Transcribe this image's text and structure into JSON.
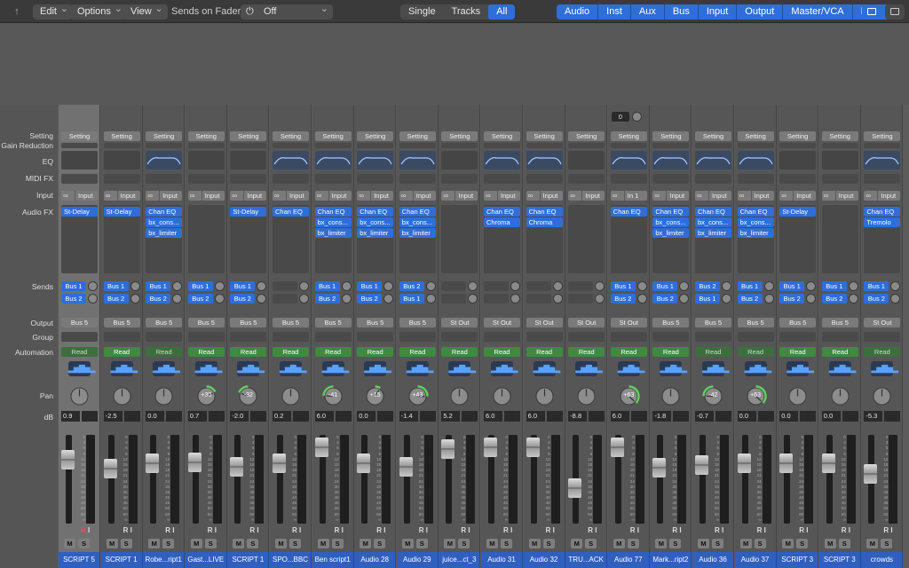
{
  "toolbar": {
    "edit": "Edit",
    "options": "Options",
    "view": "View",
    "sends_label": "Sends on Faders:",
    "sends_value": "Off",
    "views": [
      "Single",
      "Tracks",
      "All"
    ],
    "view_active": 2,
    "filters": [
      "Audio",
      "Inst",
      "Aux",
      "Bus",
      "Input",
      "Output",
      "Master/VCA",
      "MIDI"
    ]
  },
  "labels": {
    "setting": "Setting",
    "gain_reduction": "Gain Reduction",
    "eq": "EQ",
    "midi_fx": "MIDI FX",
    "input": "Input",
    "audio_fx": "Audio FX",
    "sends": "Sends",
    "output": "Output",
    "group": "Group",
    "automation": "Automation",
    "pan": "Pan",
    "db": "dB"
  },
  "common": {
    "setting": "Setting",
    "input": "Input",
    "read": "Read",
    "mute": "M",
    "solo": "S",
    "record": "R",
    "input_monitor": "I"
  },
  "scale": [
    "0",
    "3",
    "6",
    "9",
    "12",
    "15",
    "18",
    "21",
    "24",
    "30",
    "35",
    "40",
    "45",
    "50",
    "60",
    "∞"
  ],
  "channels": [
    {
      "name": "SCRIPT 5",
      "eq": false,
      "input": "Input",
      "fx": [
        "St-Delay"
      ],
      "sends": [
        "Bus 1",
        "Bus 2"
      ],
      "output": "Bus 5",
      "auto_dim": true,
      "pan": 0,
      "db": "0.9",
      "fader": 0.28,
      "rec": true,
      "sel": true
    },
    {
      "name": "SCRIPT 1",
      "eq": false,
      "input": "Input",
      "fx": [
        "St-Delay"
      ],
      "sends": [
        "Bus 1",
        "Bus 2"
      ],
      "output": "Bus 5",
      "auto_dim": false,
      "pan": 0,
      "db": "-2.5",
      "fader": 0.38,
      "rec": false
    },
    {
      "name": "Robe...ript1",
      "eq": true,
      "input": "Input",
      "fx": [
        "Chan EQ",
        "bx_cons...",
        "bx_limiter"
      ],
      "sends": [
        "Bus 1",
        "Bus 2"
      ],
      "output": "Bus 5",
      "auto_dim": true,
      "pan": 0,
      "db": "0.0",
      "fader": 0.32,
      "rec": false
    },
    {
      "name": "Gast...LIVE",
      "eq": false,
      "input": "Input",
      "fx": [],
      "sends": [
        "Bus 1",
        "Bus 2"
      ],
      "output": "Bus 5",
      "auto_dim": false,
      "pan": 30,
      "db": "0.7",
      "fader": 0.31,
      "rec": false
    },
    {
      "name": "SCRIPT 1",
      "eq": false,
      "input": "Input",
      "fx": [
        "St-Delay"
      ],
      "sends": [
        "Bus 1",
        "Bus 2"
      ],
      "output": "Bus 5",
      "auto_dim": false,
      "pan": -32,
      "db": "-2.0",
      "fader": 0.36,
      "rec": false
    },
    {
      "name": "SPO...BBC",
      "eq": true,
      "input": "Input",
      "fx": [
        "Chan EQ"
      ],
      "sends": [],
      "output": "Bus 5",
      "auto_dim": false,
      "pan": 0,
      "db": "0.2",
      "fader": 0.32,
      "rec": false
    },
    {
      "name": "Ben script1",
      "eq": true,
      "input": "Input",
      "fx": [
        "Chan EQ",
        "bx_cons...",
        "bx_limiter"
      ],
      "sends": [
        "Bus 1",
        "Bus 2"
      ],
      "output": "Bus 5",
      "auto_dim": false,
      "pan": -41,
      "db": "6.0",
      "fader": 0.14,
      "rec": false
    },
    {
      "name": "Audio 28",
      "eq": true,
      "input": "Input",
      "fx": [
        "Chan EQ",
        "bx_cons...",
        "bx_limiter"
      ],
      "sends": [
        "Bus 1",
        "Bus 2"
      ],
      "output": "Bus 5",
      "auto_dim": false,
      "pan": 15,
      "db": "0.0",
      "fader": 0.32,
      "rec": false
    },
    {
      "name": "Audio 29",
      "eq": true,
      "input": "Input",
      "fx": [
        "Chan EQ",
        "bx_cons...",
        "bx_limiter"
      ],
      "sends": [
        "Bus 2",
        "Bus 1"
      ],
      "output": "Bus 5",
      "auto_dim": false,
      "pan": 43,
      "db": "-1.4",
      "fader": 0.36,
      "rec": false
    },
    {
      "name": "juice...ct_3",
      "eq": false,
      "input": "Input",
      "fx": [],
      "sends": [],
      "output": "St Out",
      "auto_dim": false,
      "pan": 0,
      "db": "5.2",
      "fader": 0.16,
      "rec": false
    },
    {
      "name": "Audio 31",
      "eq": true,
      "input": "Input",
      "fx": [
        "Chan EQ",
        "Chroma"
      ],
      "sends": [],
      "output": "St Out",
      "auto_dim": false,
      "pan": 0,
      "db": "6.0",
      "fader": 0.14,
      "rec": false
    },
    {
      "name": "Audio 32",
      "eq": true,
      "input": "Input",
      "fx": [
        "Chan EQ",
        "Chroma"
      ],
      "sends": [],
      "output": "St Out",
      "auto_dim": false,
      "pan": 0,
      "db": "6.0",
      "fader": 0.14,
      "rec": false
    },
    {
      "name": "TRU...ACK",
      "eq": false,
      "input": "Input",
      "fx": [],
      "sends": [],
      "output": "St Out",
      "auto_dim": false,
      "pan": 0,
      "db": "-8.8",
      "fader": 0.6,
      "rec": false
    },
    {
      "name": "Audio 77",
      "eq": true,
      "input": "In 1",
      "fx": [
        "Chan EQ"
      ],
      "sends": [
        "Bus 1",
        "Bus 2"
      ],
      "output": "St Out",
      "auto_dim": false,
      "pan": 63,
      "db": "6.0",
      "fader": 0.14,
      "rec": false,
      "extra_value": "0"
    },
    {
      "name": "Mark...ript2",
      "eq": true,
      "input": "Input",
      "fx": [
        "Chan EQ",
        "bx_cons...",
        "bx_limiter"
      ],
      "sends": [
        "Bus 1",
        "Bus 2"
      ],
      "output": "Bus 5",
      "auto_dim": false,
      "pan": 0,
      "db": "-1.8",
      "fader": 0.37,
      "rec": false
    },
    {
      "name": "Audio 36",
      "eq": true,
      "input": "Input",
      "fx": [
        "Chan EQ",
        "bx_cons...",
        "bx_limiter"
      ],
      "sends": [
        "Bus 2",
        "Bus 1"
      ],
      "output": "Bus 5",
      "auto_dim": true,
      "pan": -42,
      "db": "-0.7",
      "fader": 0.34,
      "rec": false
    },
    {
      "name": "Audio 37",
      "eq": true,
      "input": "Input",
      "fx": [
        "Chan EQ",
        "bx_cons...",
        "bx_limiter"
      ],
      "sends": [
        "Bus 1",
        "Bus 2"
      ],
      "output": "Bus 5",
      "auto_dim": true,
      "pan": 63,
      "db": "0.0",
      "fader": 0.32,
      "rec": false
    },
    {
      "name": "SCRIPT 3",
      "eq": false,
      "input": "Input",
      "fx": [
        "St-Delay"
      ],
      "sends": [
        "Bus 1",
        "Bus 2"
      ],
      "output": "Bus 5",
      "auto_dim": false,
      "pan": 0,
      "db": "0.0",
      "fader": 0.32,
      "rec": false
    },
    {
      "name": "SCRIPT 3",
      "eq": false,
      "input": "Input",
      "fx": [],
      "sends": [
        "Bus 1",
        "Bus 2"
      ],
      "output": "Bus 5",
      "auto_dim": false,
      "pan": 0,
      "db": "0.0",
      "fader": 0.32,
      "rec": false
    },
    {
      "name": "crowds",
      "eq": true,
      "input": "Input",
      "fx": [
        "Chan EQ",
        "Tremolo"
      ],
      "sends": [
        "Bus 1",
        "Bus 2"
      ],
      "output": "St Out",
      "auto_dim": true,
      "pan": 0,
      "db": "-5.3",
      "fader": 0.44,
      "rec": false
    }
  ]
}
